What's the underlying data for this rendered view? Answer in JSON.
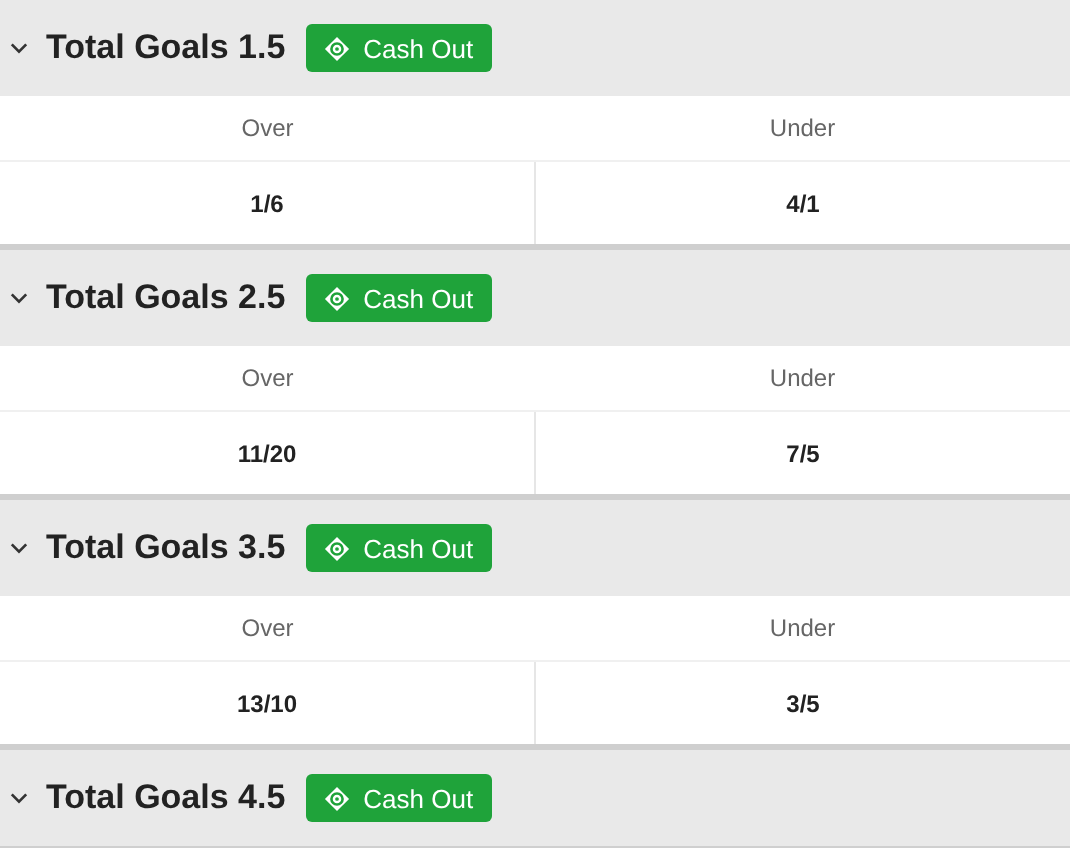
{
  "markets": [
    {
      "title": "Total Goals 1.5",
      "expanded": true,
      "cash_out": "Cash Out",
      "outcomes": [
        {
          "label": "Over",
          "odds": "1/6"
        },
        {
          "label": "Under",
          "odds": "4/1"
        }
      ]
    },
    {
      "title": "Total Goals 2.5",
      "expanded": true,
      "cash_out": "Cash Out",
      "outcomes": [
        {
          "label": "Over",
          "odds": "11/20"
        },
        {
          "label": "Under",
          "odds": "7/5"
        }
      ]
    },
    {
      "title": "Total Goals 3.5",
      "expanded": true,
      "cash_out": "Cash Out",
      "outcomes": [
        {
          "label": "Over",
          "odds": "13/10"
        },
        {
          "label": "Under",
          "odds": "3/5"
        }
      ]
    },
    {
      "title": "Total Goals 4.5",
      "expanded": true,
      "cash_out": "Cash Out"
    }
  ]
}
